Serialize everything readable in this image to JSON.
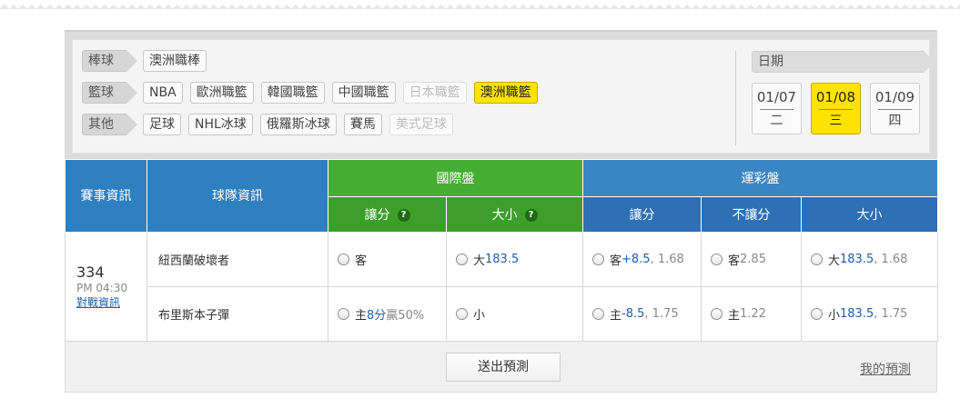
{
  "filters": {
    "rows": [
      {
        "label": "棒球",
        "chips": [
          {
            "text": "澳洲職棒",
            "state": "normal"
          }
        ]
      },
      {
        "label": "籃球",
        "chips": [
          {
            "text": "NBA",
            "state": "normal"
          },
          {
            "text": "歐洲職籃",
            "state": "normal"
          },
          {
            "text": "韓國職籃",
            "state": "normal"
          },
          {
            "text": "中國職籃",
            "state": "normal"
          },
          {
            "text": "日本職籃",
            "state": "disabled"
          },
          {
            "text": "澳洲職籃",
            "state": "active"
          }
        ]
      },
      {
        "label": "其他",
        "chips": [
          {
            "text": "足球",
            "state": "normal"
          },
          {
            "text": "NHL冰球",
            "state": "normal"
          },
          {
            "text": "俄羅斯冰球",
            "state": "normal"
          },
          {
            "text": "賽馬",
            "state": "normal"
          },
          {
            "text": "美式足球",
            "state": "disabled"
          }
        ]
      }
    ],
    "date": {
      "label": "日期",
      "days": [
        {
          "date": "01/07",
          "weekday": "二",
          "active": false
        },
        {
          "date": "01/08",
          "weekday": "三",
          "active": true
        },
        {
          "date": "01/09",
          "weekday": "四",
          "active": false
        }
      ]
    }
  },
  "table": {
    "headers": {
      "event": "賽事資訊",
      "team": "球隊資訊",
      "intl": "國際盤",
      "lottery": "運彩盤",
      "intl_spread": "讓分",
      "intl_total": "大小",
      "help": "?",
      "lot_spread": "讓分",
      "lot_nospread": "不讓分",
      "lot_total": "大小"
    },
    "event": {
      "no": "334",
      "time": "PM 04:30",
      "link": "對戰資訊"
    },
    "rows": [
      {
        "team": "紐西蘭破壞者",
        "intl_spread": {
          "prefix": "客",
          "value": "",
          "odds": ""
        },
        "intl_total": {
          "prefix": "大",
          "value": "183.5"
        },
        "lot_spread": {
          "prefix": "客",
          "value": "+8.5",
          "odds": "1.68"
        },
        "lot_nospread": {
          "prefix": "客",
          "odds": "2.85"
        },
        "lot_total": {
          "prefix": "大",
          "value": "183.5",
          "odds": "1.68"
        }
      },
      {
        "team": "布里斯本子彈",
        "intl_spread": {
          "prefix": "主",
          "value": "8分",
          "odds": "贏50%"
        },
        "intl_total": {
          "prefix": "小",
          "value": ""
        },
        "lot_spread": {
          "prefix": "主",
          "value": "-8.5",
          "odds": "1.75"
        },
        "lot_nospread": {
          "prefix": "主",
          "odds": "1.22"
        },
        "lot_total": {
          "prefix": "小",
          "value": "183.5",
          "odds": "1.75"
        }
      }
    ]
  },
  "footer": {
    "submit": "送出預測",
    "my_link": "我的預測"
  },
  "colors": {
    "active_yellow": "#ffe300",
    "header_blue": "#2f80c1",
    "intl_green": "#45ad33",
    "link_blue": "#1f5ea8"
  }
}
